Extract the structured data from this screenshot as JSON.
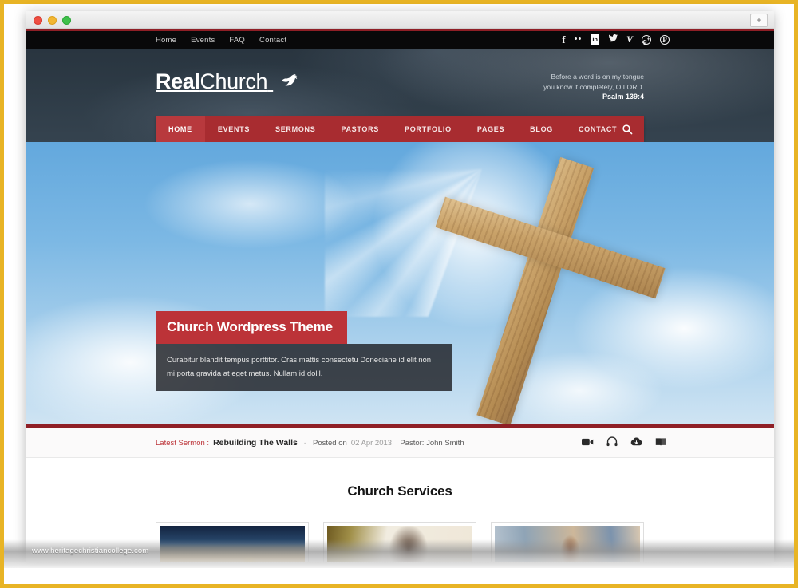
{
  "browser": {
    "traffic_lights": [
      "close",
      "minimize",
      "zoom"
    ],
    "new_tab_label": "+"
  },
  "topbar": {
    "links": [
      {
        "label": "Home"
      },
      {
        "label": "Events"
      },
      {
        "label": "FAQ"
      },
      {
        "label": "Contact"
      }
    ],
    "social": [
      {
        "name": "facebook-icon",
        "glyph": "f"
      },
      {
        "name": "flickr-icon",
        "glyph": "••"
      },
      {
        "name": "linkedin-icon",
        "glyph": "in"
      },
      {
        "name": "twitter-icon",
        "glyph": "🐦"
      },
      {
        "name": "vimeo-icon",
        "glyph": "V"
      },
      {
        "name": "googleplus-icon",
        "glyph": "g+"
      },
      {
        "name": "pinterest-icon",
        "glyph": "P"
      }
    ]
  },
  "brand": {
    "name_bold": "Real",
    "name_light": "Church",
    "dove_icon": "dove-icon"
  },
  "verse": {
    "line1": "Before a word is on my tongue",
    "line2": "you know it completely, O LORD.",
    "reference": "Psalm 139:4"
  },
  "mainnav": {
    "items": [
      {
        "label": "HOME",
        "active": true
      },
      {
        "label": "EVENTS",
        "active": false
      },
      {
        "label": "SERMONS",
        "active": false
      },
      {
        "label": "PASTORS",
        "active": false
      },
      {
        "label": "PORTFOLIO",
        "active": false
      },
      {
        "label": "PAGES",
        "active": false
      },
      {
        "label": "BLOG",
        "active": false
      },
      {
        "label": "CONTACT",
        "active": false
      }
    ],
    "search_icon": "search-icon"
  },
  "slider": {
    "caption_title": "Church Wordpress Theme",
    "caption_body": "Curabitur blandit tempus porttitor. Cras mattis consectetu Doneciane id elit non mi porta gravida at eget metus. Nullam id dolil.",
    "image_alt": "wooden-cross-in-bright-sky"
  },
  "sermon_bar": {
    "label": "Latest Sermon :",
    "title": "Rebuilding The Walls",
    "separator": "-",
    "posted_prefix": "Posted on",
    "date": "02 Apr 2013",
    "pastor": ", Pastor: John Smith",
    "icons": [
      {
        "name": "video-camera-icon",
        "glyph": "🎥"
      },
      {
        "name": "headphones-icon",
        "glyph": "🎧"
      },
      {
        "name": "cloud-download-icon",
        "glyph": "☁"
      },
      {
        "name": "book-icon",
        "glyph": "📖"
      }
    ]
  },
  "services": {
    "heading": "Church Services",
    "cards": [
      {
        "image_alt": "church-dome-at-sunset"
      },
      {
        "image_alt": "woman-praying"
      },
      {
        "image_alt": "congregation-with-cross"
      }
    ]
  },
  "watermark": {
    "text": "www.heritagechristiancollege.com"
  },
  "colors": {
    "accent_red": "#a82c30",
    "accent_red_active": "#b8393d",
    "caption_red": "#bc3338",
    "dark_red_rule": "#8f1f26",
    "topbar_black": "#09090a",
    "frame_gold": "#e8b425"
  }
}
